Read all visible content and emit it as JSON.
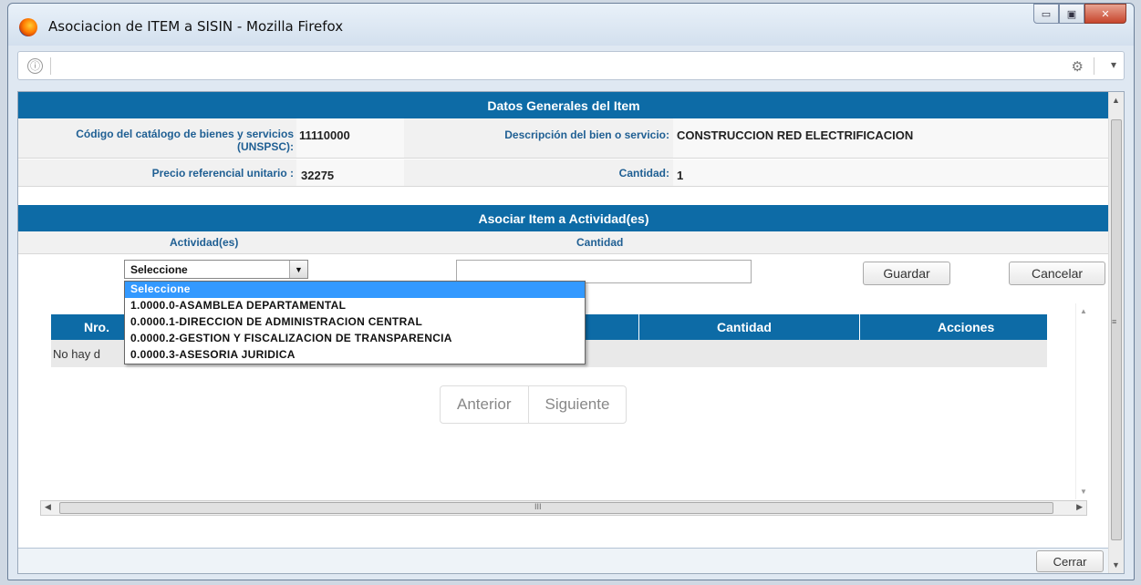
{
  "window": {
    "title": "Asociacion de ITEM a SISIN - Mozilla Firefox",
    "minimize": "▭",
    "maximize": "▣",
    "close": "✕"
  },
  "urlbar": {
    "info_icon": "ⓘ",
    "extension_icon": "⚙",
    "menu_icon": "▾"
  },
  "general": {
    "header": "Datos Generales del Item",
    "codigo_label": "Código del catálogo de bienes y servicios (UNSPSC):",
    "codigo_value": "11110000",
    "descripcion_label": "Descripción del bien o servicio:",
    "descripcion_value": "CONSTRUCCION RED ELECTRIFICACION",
    "precio_label": "Precio referencial unitario :",
    "precio_value": "32275",
    "cantidad_label": "Cantidad:",
    "cantidad_value": "1"
  },
  "asociar": {
    "header": "Asociar Item a Actividad(es)",
    "actividades_col": "Actividad(es)",
    "cantidad_col": "Cantidad",
    "select_value": "Seleccione",
    "select_arrow": "▼",
    "quantity_value": "",
    "save_label": "Guardar",
    "cancel_label": "Cancelar",
    "options": [
      "Seleccione",
      "1.0000.0-ASAMBLEA DEPARTAMENTAL",
      "0.0000.1-DIRECCION DE ADMINISTRACION CENTRAL",
      "0.0000.2-GESTION Y FISCALIZACION DE TRANSPARENCIA",
      "0.0000.3-ASESORIA JURIDICA"
    ]
  },
  "grid": {
    "col_nro": "Nro.",
    "col_cantidad": "Cantidad",
    "col_acciones": "Acciones",
    "empty_text": "No hay d",
    "prev_label": "Anterior",
    "next_label": "Siguiente"
  },
  "scroll": {
    "up": "▲",
    "down": "▼",
    "left": "◀",
    "right": "▶",
    "grip": "≡",
    "hgrip": "III"
  },
  "footer": {
    "close_label": "Cerrar"
  },
  "colors": {
    "header_blue": "#0d6ba6",
    "label_blue": "#1f5f93",
    "selected": "#3399ff"
  }
}
